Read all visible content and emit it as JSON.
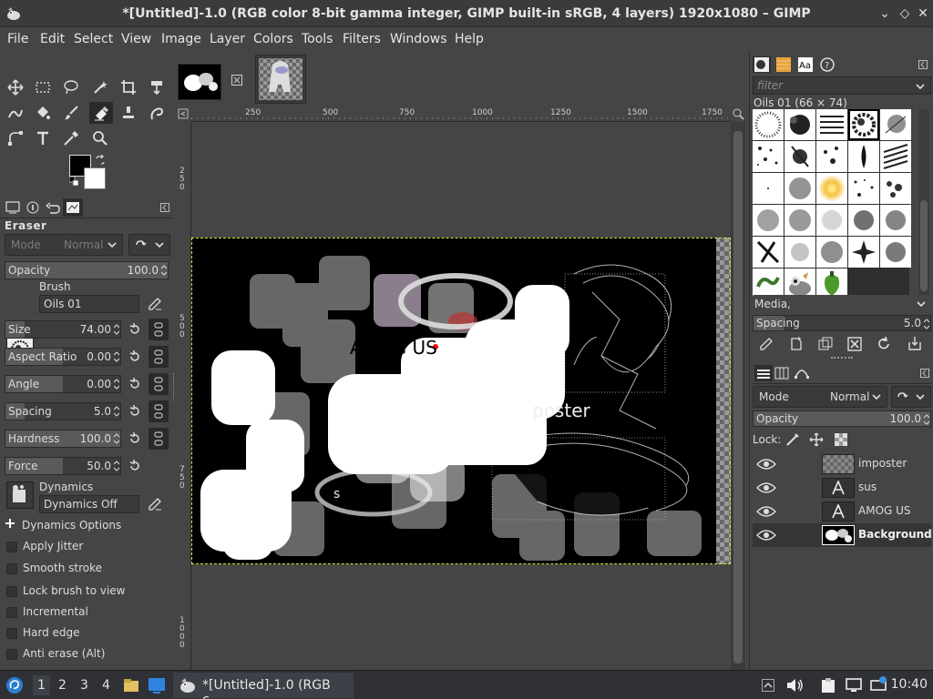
{
  "window": {
    "title": "*[Untitled]-1.0 (RGB color 8-bit gamma integer, GIMP built-in sRGB, 4 layers) 1920x1080 – GIMP",
    "minimize_glyph": "⌄",
    "maximize_glyph": "◇",
    "close_glyph": "✕"
  },
  "menu": [
    "File",
    "Edit",
    "Select",
    "View",
    "Image",
    "Layer",
    "Colors",
    "Tools",
    "Filters",
    "Windows",
    "Help"
  ],
  "tool_options": {
    "heading": "Eraser",
    "mode_label": "Mode",
    "mode_value": "Normal",
    "opacity_label": "Opacity",
    "opacity_value": "100.0",
    "opacity_fraction": 1.0,
    "brush_label": "Brush",
    "brush_value": "Oils 01",
    "size_label": "Size",
    "size_value": "74.00",
    "size_fraction": 0.17,
    "aspect_label": "Aspect Ratio",
    "aspect_value": "0.00",
    "aspect_fraction": 0.5,
    "angle_label": "Angle",
    "angle_value": "0.00",
    "angle_fraction": 0.5,
    "spacing_label": "Spacing",
    "spacing_value": "5.0",
    "spacing_fraction": 0.17,
    "hardness_label": "Hardness",
    "hardness_value": "100.0",
    "hardness_fraction": 1.0,
    "force_label": "Force",
    "force_value": "50.0",
    "force_fraction": 0.5,
    "dynamics_label": "Dynamics",
    "dynamics_value": "Dynamics Off",
    "dynamics_options": "Dynamics Options",
    "checks": [
      "Apply Jitter",
      "Smooth stroke",
      "Lock brush to view",
      "Incremental",
      "Hard edge",
      "Anti erase  (Alt)"
    ]
  },
  "rulers": {
    "h": [
      "250",
      "500",
      "750",
      "1000",
      "1250",
      "1500",
      "1750"
    ],
    "v": [
      "250",
      "500",
      "750",
      "1000"
    ]
  },
  "canvas_text": {
    "amog": "AMOG US",
    "poster": "poster",
    "small": "s"
  },
  "brushes": {
    "filter_placeholder": "filter",
    "selected": "Oils 01 (66 × 74)",
    "tag_value": "Media,",
    "spacing_label": "Spacing",
    "spacing_value": "5.0"
  },
  "layers": {
    "mode_label": "Mode",
    "mode_value": "Normal",
    "opacity_label": "Opacity",
    "opacity_value": "100.0",
    "lock_label": "Lock:",
    "items": [
      "imposter",
      "sus",
      "AMOG US",
      "Background"
    ]
  },
  "taskbar": {
    "workspaces": [
      "1",
      "2",
      "3",
      "4"
    ],
    "task_title": "*[Untitled]-1.0 (RGB c...",
    "clock": "10:40"
  }
}
